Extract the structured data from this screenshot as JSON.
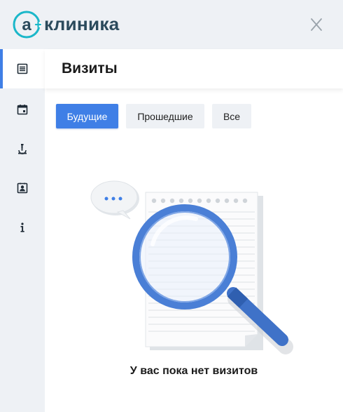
{
  "app": {
    "logo_text": "клиника",
    "logo_letter": "a"
  },
  "sidebar": {
    "items": [
      {
        "icon": "document-list-icon",
        "active": true
      },
      {
        "icon": "calendar-icon",
        "active": false
      },
      {
        "icon": "microscope-icon",
        "active": false
      },
      {
        "icon": "contact-card-icon",
        "active": false
      },
      {
        "icon": "info-icon",
        "active": false
      }
    ]
  },
  "main": {
    "title": "Визиты",
    "tabs": [
      {
        "label": "Будущие",
        "active": true
      },
      {
        "label": "Прошедшие",
        "active": false
      },
      {
        "label": "Все",
        "active": false
      }
    ],
    "empty_message": "У вас пока нет визитов"
  },
  "colors": {
    "accent": "#3f7fe6",
    "sidebar_bg": "#eef1f5",
    "logo_text": "#2b4a5c",
    "logo_teal": "#1bb7c9"
  }
}
